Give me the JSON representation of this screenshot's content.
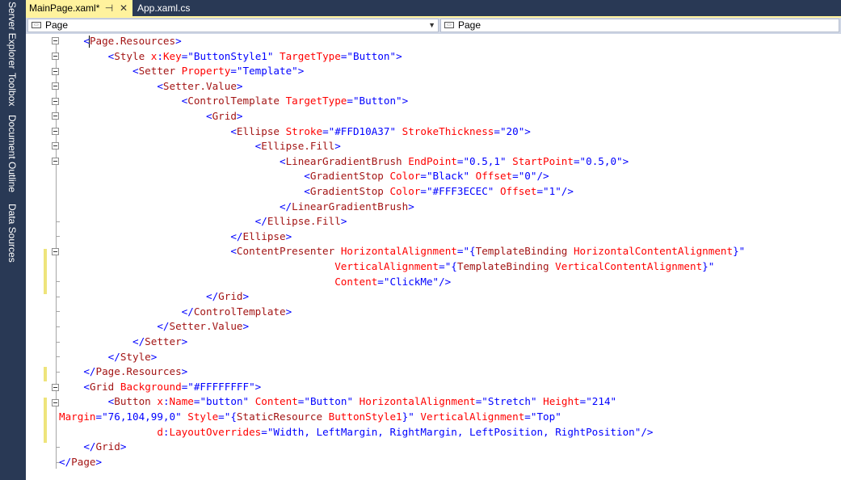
{
  "side_tabs": [
    "Server Explorer",
    "Toolbox",
    "Document Outline",
    "Data Sources"
  ],
  "doc_tabs": {
    "active": "MainPage.xaml*",
    "pin_icon": "pin-icon",
    "close_icon": "close-icon",
    "inactive": "App.xaml.cs"
  },
  "nav": {
    "left_combo": "Page",
    "right_combo": "Page"
  },
  "code_lines": [
    {
      "indent": "    ",
      "tokens": [
        [
          "v",
          "<"
        ],
        [
          "t",
          "Page.Resources"
        ],
        [
          "v",
          ">"
        ]
      ]
    },
    {
      "indent": "        ",
      "tokens": [
        [
          "v",
          "<"
        ],
        [
          "t",
          "Style"
        ],
        [
          "a",
          " x"
        ],
        [
          "v",
          ":"
        ],
        [
          "a",
          "Key"
        ],
        [
          "v",
          "=\"ButtonStyle1\""
        ],
        [
          "a",
          " TargetType"
        ],
        [
          "v",
          "=\"Button\">"
        ]
      ]
    },
    {
      "indent": "            ",
      "tokens": [
        [
          "v",
          "<"
        ],
        [
          "t",
          "Setter"
        ],
        [
          "a",
          " Property"
        ],
        [
          "v",
          "=\"Template\">"
        ]
      ]
    },
    {
      "indent": "                ",
      "tokens": [
        [
          "v",
          "<"
        ],
        [
          "t",
          "Setter.Value"
        ],
        [
          "v",
          ">"
        ]
      ]
    },
    {
      "indent": "                    ",
      "tokens": [
        [
          "v",
          "<"
        ],
        [
          "t",
          "ControlTemplate"
        ],
        [
          "a",
          " TargetType"
        ],
        [
          "v",
          "=\"Button\">"
        ]
      ]
    },
    {
      "indent": "                        ",
      "tokens": [
        [
          "v",
          "<"
        ],
        [
          "t",
          "Grid"
        ],
        [
          "v",
          ">"
        ]
      ]
    },
    {
      "indent": "                            ",
      "tokens": [
        [
          "v",
          "<"
        ],
        [
          "t",
          "Ellipse"
        ],
        [
          "a",
          " Stroke"
        ],
        [
          "v",
          "=\"#FFD10A37\""
        ],
        [
          "a",
          " StrokeThickness"
        ],
        [
          "v",
          "=\"20\">"
        ]
      ]
    },
    {
      "indent": "                                ",
      "tokens": [
        [
          "v",
          "<"
        ],
        [
          "t",
          "Ellipse.Fill"
        ],
        [
          "v",
          ">"
        ]
      ]
    },
    {
      "indent": "                                    ",
      "tokens": [
        [
          "v",
          "<"
        ],
        [
          "t",
          "LinearGradientBrush"
        ],
        [
          "a",
          " EndPoint"
        ],
        [
          "v",
          "=\"0.5,1\""
        ],
        [
          "a",
          " StartPoint"
        ],
        [
          "v",
          "=\"0.5,0\">"
        ]
      ]
    },
    {
      "indent": "                                        ",
      "tokens": [
        [
          "v",
          "<"
        ],
        [
          "t",
          "GradientStop"
        ],
        [
          "a",
          " Color"
        ],
        [
          "v",
          "=\"Black\""
        ],
        [
          "a",
          " Offset"
        ],
        [
          "v",
          "=\"0\"/>"
        ]
      ]
    },
    {
      "indent": "                                        ",
      "tokens": [
        [
          "v",
          "<"
        ],
        [
          "t",
          "GradientStop"
        ],
        [
          "a",
          " Color"
        ],
        [
          "v",
          "=\"#FFF3ECEC\""
        ],
        [
          "a",
          " Offset"
        ],
        [
          "v",
          "=\"1\"/>"
        ]
      ]
    },
    {
      "indent": "                                    ",
      "tokens": [
        [
          "v",
          "</"
        ],
        [
          "t",
          "LinearGradientBrush"
        ],
        [
          "v",
          ">"
        ]
      ]
    },
    {
      "indent": "                                ",
      "tokens": [
        [
          "v",
          "</"
        ],
        [
          "t",
          "Ellipse.Fill"
        ],
        [
          "v",
          ">"
        ]
      ]
    },
    {
      "indent": "                            ",
      "tokens": [
        [
          "v",
          "</"
        ],
        [
          "t",
          "Ellipse"
        ],
        [
          "v",
          ">"
        ]
      ]
    },
    {
      "indent": "                            ",
      "tokens": [
        [
          "v",
          "<"
        ],
        [
          "t",
          "ContentPresenter"
        ],
        [
          "a",
          " HorizontalAlignment"
        ],
        [
          "v",
          "=\"{"
        ],
        [
          "t",
          "TemplateBinding"
        ],
        [
          "a",
          " HorizontalContentAlignment"
        ],
        [
          "v",
          "}\""
        ]
      ]
    },
    {
      "indent": "                                             ",
      "tokens": [
        [
          "a",
          "VerticalAlignment"
        ],
        [
          "v",
          "=\"{"
        ],
        [
          "t",
          "TemplateBinding"
        ],
        [
          "a",
          " VerticalContentAlignment"
        ],
        [
          "v",
          "}\""
        ]
      ]
    },
    {
      "indent": "                                             ",
      "tokens": [
        [
          "a",
          "Content"
        ],
        [
          "v",
          "=\"ClickMe\"/>"
        ]
      ]
    },
    {
      "indent": "                        ",
      "tokens": [
        [
          "v",
          "</"
        ],
        [
          "t",
          "Grid"
        ],
        [
          "v",
          ">"
        ]
      ]
    },
    {
      "indent": "                    ",
      "tokens": [
        [
          "v",
          "</"
        ],
        [
          "t",
          "ControlTemplate"
        ],
        [
          "v",
          ">"
        ]
      ]
    },
    {
      "indent": "                ",
      "tokens": [
        [
          "v",
          "</"
        ],
        [
          "t",
          "Setter.Value"
        ],
        [
          "v",
          ">"
        ]
      ]
    },
    {
      "indent": "            ",
      "tokens": [
        [
          "v",
          "</"
        ],
        [
          "t",
          "Setter"
        ],
        [
          "v",
          ">"
        ]
      ]
    },
    {
      "indent": "        ",
      "tokens": [
        [
          "v",
          "</"
        ],
        [
          "t",
          "Style"
        ],
        [
          "v",
          ">"
        ]
      ]
    },
    {
      "indent": "    ",
      "tokens": [
        [
          "v",
          "</"
        ],
        [
          "t",
          "Page.Resources"
        ],
        [
          "v",
          ">"
        ]
      ]
    },
    {
      "indent": "    ",
      "tokens": [
        [
          "v",
          "<"
        ],
        [
          "t",
          "Grid"
        ],
        [
          "a",
          " Background"
        ],
        [
          "v",
          "=\"#FFFFFFFF\">"
        ]
      ]
    },
    {
      "indent": "        ",
      "tokens": [
        [
          "v",
          "<"
        ],
        [
          "t",
          "Button"
        ],
        [
          "a",
          " x"
        ],
        [
          "v",
          ":"
        ],
        [
          "a",
          "Name"
        ],
        [
          "v",
          "=\"button\""
        ],
        [
          "a",
          " Content"
        ],
        [
          "v",
          "=\"Button\""
        ],
        [
          "a",
          " HorizontalAlignment"
        ],
        [
          "v",
          "=\"Stretch\""
        ],
        [
          "a",
          " Height"
        ],
        [
          "v",
          "=\"214\""
        ]
      ]
    },
    {
      "indent": "",
      "tokens": [
        [
          "a",
          "Margin"
        ],
        [
          "v",
          "=\"76,104,99,0\""
        ],
        [
          "a",
          " Style"
        ],
        [
          "v",
          "=\"{"
        ],
        [
          "t",
          "StaticResource"
        ],
        [
          "a",
          " ButtonStyle1"
        ],
        [
          "v",
          "}\""
        ],
        [
          "a",
          " VerticalAlignment"
        ],
        [
          "v",
          "=\"Top\""
        ]
      ]
    },
    {
      "indent": "                ",
      "tokens": [
        [
          "a",
          "d"
        ],
        [
          "v",
          ":"
        ],
        [
          "a",
          "LayoutOverrides"
        ],
        [
          "v",
          "=\"Width, LeftMargin, RightMargin, LeftPosition, RightPosition\"/>"
        ]
      ]
    },
    {
      "indent": "    ",
      "tokens": [
        [
          "v",
          "</"
        ],
        [
          "t",
          "Grid"
        ],
        [
          "v",
          ">"
        ]
      ]
    },
    {
      "indent": "",
      "tokens": [
        [
          "v",
          "</"
        ],
        [
          "t",
          "Page"
        ],
        [
          "v",
          ">"
        ]
      ]
    }
  ],
  "colors": {
    "background": "#293955",
    "active_tab": "#fff29d",
    "change_marker": "#eee47b",
    "tag": "#a31515",
    "attribute": "#ff0000",
    "value": "#0000ff"
  }
}
